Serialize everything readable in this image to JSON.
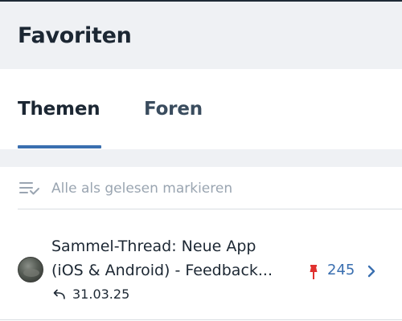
{
  "header": {
    "title": "Favoriten"
  },
  "tabs": [
    {
      "label": "Themen",
      "active": true
    },
    {
      "label": "Foren",
      "active": false
    }
  ],
  "actions": {
    "mark_all_read": "Alle als gelesen markieren",
    "icon": "mark-read-icon"
  },
  "threads": [
    {
      "title_line1": "Sammel-Thread: Neue App",
      "title_line2": "(iOS & Android) - Feedback...",
      "date": "31.03.25",
      "count": "245",
      "pinned": true
    }
  ],
  "colors": {
    "accent": "#3a6fb0",
    "pin": "#e0312f",
    "header_bg": "#eff1f4",
    "muted_text": "#9aa5b1"
  }
}
